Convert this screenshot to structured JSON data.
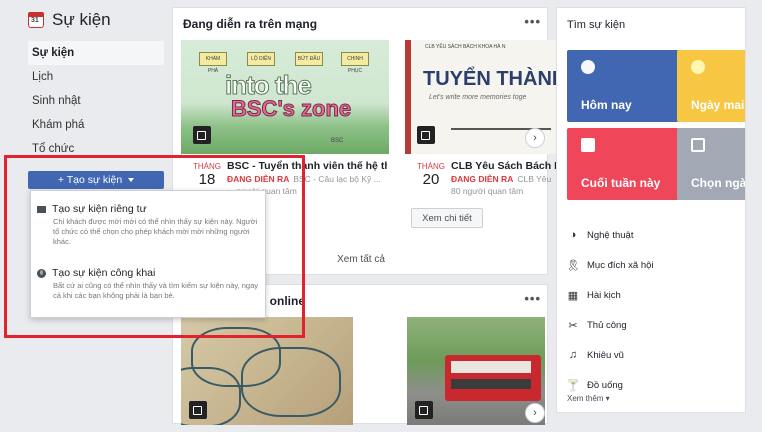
{
  "sidebar": {
    "title": "Sự kiện",
    "items": [
      {
        "label": "Sự kiện",
        "active": true
      },
      {
        "label": "Lịch"
      },
      {
        "label": "Sinh nhật"
      },
      {
        "label": "Khám phá"
      },
      {
        "label": "Tổ chức"
      }
    ],
    "create_button": "+ Tạo sự kiện"
  },
  "dropdown": {
    "private": {
      "title": "Tạo sự kiện riêng tư",
      "desc": "Chỉ khách được mời mới có thể nhìn thấy sự kiện này. Người tổ chức có thể chọn cho phép khách mời mời những người khác."
    },
    "public": {
      "title": "Tạo sự kiện công khai",
      "desc": "Bất cứ ai cũng có thể nhìn thấy và tìm kiếm sự kiện này, ngay cả khi các bạn không phải là bạn bè."
    }
  },
  "feed": {
    "title": "Đang diễn ra trên mạng",
    "more": "•••",
    "cards": [
      {
        "month": "THÁNG",
        "day": "18",
        "title": "BSC - Tuyển thành viên thế hệ th...",
        "status": "ĐANG DIỄN RA",
        "host": "BSC - Câu lạc bộ Kỹ ...",
        "interested": "... người quan tâm",
        "img_signs": [
          "KHÁM PHÁ",
          "LỘ DIỆN",
          "BỨT ĐẦU",
          "CHINH PHỤC"
        ],
        "img_big1": "into the",
        "img_big2": "BSC's zone",
        "img_small": "BSC"
      },
      {
        "month": "THÁNG",
        "day": "20",
        "title": "CLB Yêu Sách Bách K",
        "status": "ĐANG DIỄN RA",
        "host": "CLB Yêu",
        "interested": "80 người quan tâm",
        "img_header": "CLB YÊU SÁCH BÁCH KHOA HÀ N",
        "img_big": "TUYỂN THÀNH V",
        "img_script": "Let's write more memories toge",
        "button": "Xem chi tiết"
      }
    ],
    "see_all": "Xem tất cả",
    "arrow": "›"
  },
  "feed2": {
    "title": "n online",
    "more": "•••",
    "arrow": "›"
  },
  "right": {
    "title": "Tìm sự kiện",
    "tiles": [
      {
        "label": "Hôm nay",
        "color": "#4267b2"
      },
      {
        "label": "Ngày mai",
        "color": "#f7c744"
      },
      {
        "label": "Cuối tuần này",
        "color": "#f0465a"
      },
      {
        "label": "Chọn ngày",
        "color": "#a2a9b5"
      }
    ],
    "categories": [
      {
        "label": "Nghệ thuật",
        "icon": "palette-icon"
      },
      {
        "label": "Mục đích xã hội",
        "icon": "ribbon-icon"
      },
      {
        "label": "Hài kịch",
        "icon": "comedy-icon"
      },
      {
        "label": "Thủ công",
        "icon": "scissors-icon"
      },
      {
        "label": "Khiêu vũ",
        "icon": "music-icon"
      },
      {
        "label": "Đồ uống",
        "icon": "cocktail-icon"
      }
    ],
    "see_more": "Xem thêm ▾"
  }
}
